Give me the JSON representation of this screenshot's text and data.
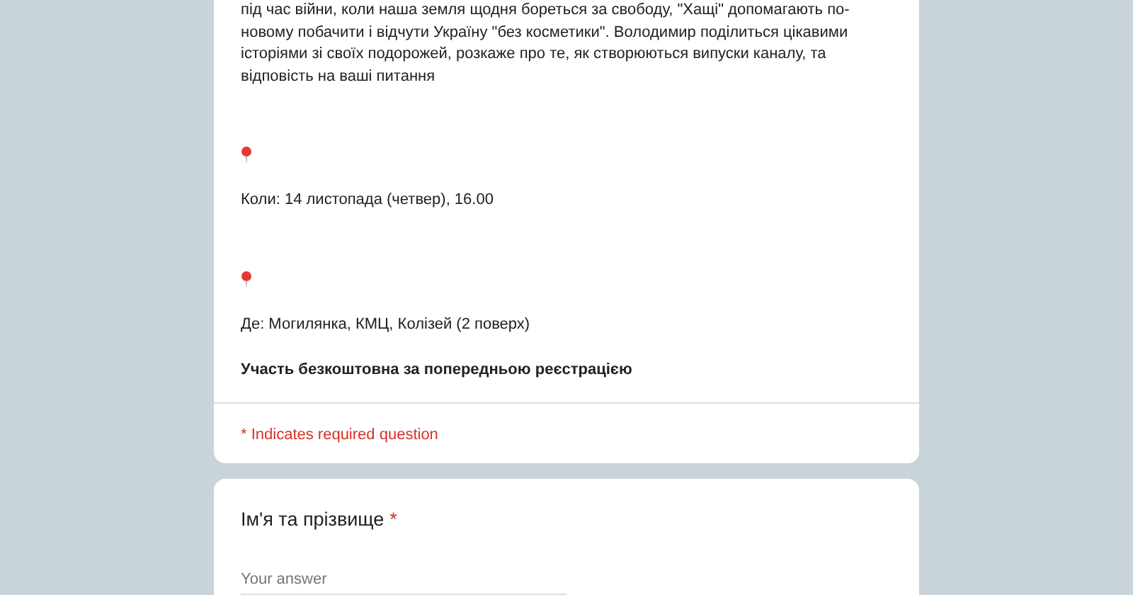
{
  "description_lines": [
    "під час війни, коли наша земля щодня бореться за свободу, \"Хащі\" допомагають по-",
    "новому побачити і відчути Україну \"без косметики\". Володимир поділиться цікавими",
    "історіями зі своїх подорожей, розкаже про те, як створюються випуски каналу, та",
    "відповість на ваші питання"
  ],
  "details": [
    {
      "kind": "pin"
    },
    {
      "kind": "text",
      "text": "Коли: 14 листопада (четвер), 16.00"
    },
    {
      "kind": "pin"
    },
    {
      "kind": "text",
      "text": "Де: Могилянка, КМЦ, Колізей (2 поверх)"
    },
    {
      "kind": "bold",
      "text": "Участь безкоштовна за попередньою реєстрацією"
    }
  ],
  "required_note": "* Indicates required question",
  "questions": [
    {
      "title": "Ім'я та прізвище",
      "required_mark": "*",
      "placeholder": "Your answer"
    }
  ]
}
